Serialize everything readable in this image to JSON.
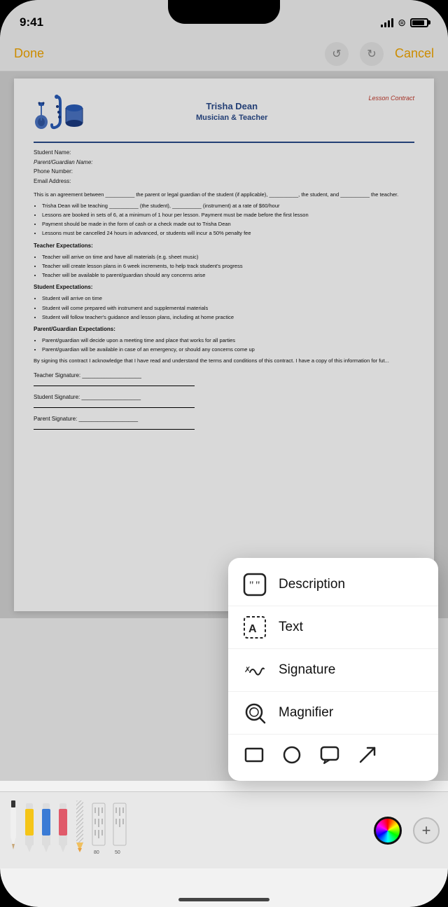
{
  "status_bar": {
    "time": "9:41"
  },
  "toolbar": {
    "done_label": "Done",
    "cancel_label": "Cancel"
  },
  "document": {
    "title_name": "Trisha Dean",
    "title_sub": "Musician & Teacher",
    "contract_label": "Lesson Contract",
    "fields": {
      "student_name": "Student Name:",
      "guardian_name": "Parent/Guardian Name:",
      "phone": "Phone Number:",
      "email": "Email Address:"
    },
    "body_intro": "This is an agreement between __________ the parent or legal guardian of the student (if applicable), __________, the student, and __________ the teacher.",
    "bullet1": "Trisha Dean will be teaching __________ (the student), __________ (instrument) at a rate of $60/hour",
    "bullet2": "Lessons are booked in sets of 6, at a minimum of 1 hour per lesson. Payment must be made before the first lesson",
    "bullet3": "Payment should be made in the form of cash or a check made out to Trisha Dean",
    "bullet4": "Lessons must be cancelled 24 hours in advanced, or students will incur a 50% penalty fee",
    "teacher_exp_title": "Teacher Expectations:",
    "teacher_bullets": [
      "Teacher will arrive on time and have all materials (e.g. sheet music)",
      "Teacher will create lesson plans in 6 week increments, to help track student's progress",
      "Teacher will be available to parent/guardian should any concerns arise"
    ],
    "student_exp_title": "Student Expectations:",
    "student_bullets": [
      "Student will arrive on time",
      "Student will come prepared with instrument and supplemental materials",
      "Student will follow teacher's guidance and lesson plans, including at home practice"
    ],
    "parent_exp_title": "Parent/Guardian Expectations:",
    "parent_bullets": [
      "Parent/guardian will decide upon a meeting time and place that works for all parties",
      "Parent/guardian will be available in case of an emergency, or should any concerns come up"
    ],
    "closing": "By signing this contract I acknowledge that I have read and understand the terms and conditions of this contract. I have a copy of this information for fut...",
    "teacher_sig": "Teacher Signature: ___________________",
    "student_sig": "Student Signature: ___________________",
    "parent_sig": "Parent Signature: ___________________"
  },
  "popup_menu": {
    "items": [
      {
        "id": "description",
        "label": "Description"
      },
      {
        "id": "text",
        "label": "Text"
      },
      {
        "id": "signature",
        "label": "Signature"
      },
      {
        "id": "magnifier",
        "label": "Magnifier"
      }
    ],
    "shapes": [
      "rectangle",
      "circle",
      "speech-bubble",
      "arrow"
    ]
  },
  "drawing_toolbar": {
    "tools": [
      {
        "id": "pen",
        "type": "pen"
      },
      {
        "id": "highlighter-yellow",
        "type": "highlighter",
        "color": "#f5c518"
      },
      {
        "id": "highlighter-blue",
        "type": "highlighter",
        "color": "#3a7bd5"
      },
      {
        "id": "highlighter-pink",
        "type": "highlighter",
        "color": "#e05a6a"
      },
      {
        "id": "pencil",
        "type": "pencil"
      },
      {
        "id": "ruler",
        "type": "ruler",
        "number": "80"
      },
      {
        "id": "ruler2",
        "type": "ruler",
        "number": "50"
      }
    ]
  }
}
